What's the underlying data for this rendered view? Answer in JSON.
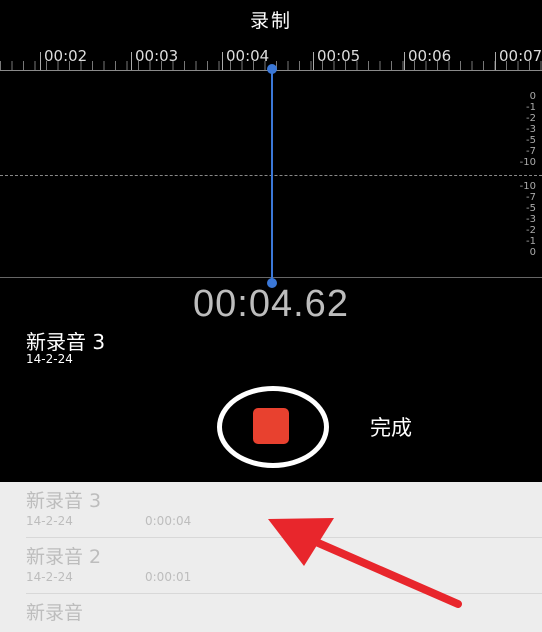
{
  "header": {
    "title": "录制"
  },
  "timeline": {
    "labels": [
      "00:02",
      "00:03",
      "00:04",
      "00:05",
      "00:06",
      "00:07"
    ]
  },
  "meter": {
    "upper_labels": [
      "0",
      "-1",
      "-2",
      "-3",
      "-5",
      "-7",
      "-10"
    ],
    "lower_labels": [
      "-10",
      "-7",
      "-5",
      "-3",
      "-2",
      "-1",
      "0"
    ]
  },
  "timer": "00:04.62",
  "current_recording": {
    "name": "新录音 3",
    "date": "14-2-24"
  },
  "controls": {
    "done_label": "完成"
  },
  "recordings": [
    {
      "name": "新录音 3",
      "date": "14-2-24",
      "duration": "0:00:04"
    },
    {
      "name": "新录音 2",
      "date": "14-2-24",
      "duration": "0:00:01"
    },
    {
      "name": "新录音"
    }
  ],
  "colors": {
    "playhead": "#3b78d8",
    "stop": "#e8412f",
    "arrow": "#e8262c"
  },
  "icons": {
    "record_stop": "stop-square-icon",
    "annotation": "red-arrow-icon"
  }
}
